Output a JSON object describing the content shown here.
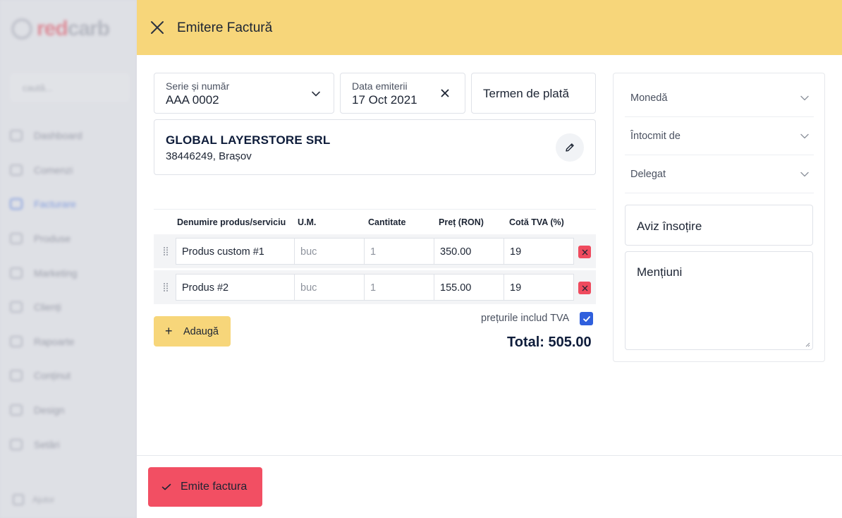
{
  "background_app": {
    "logo": {
      "part1": "red",
      "part2": "carb"
    },
    "search_placeholder": "caută...",
    "nav": [
      {
        "label": "Dashboard",
        "icon": "dashboard-icon"
      },
      {
        "label": "Comenzi",
        "icon": "cart-icon"
      },
      {
        "label": "Facturare",
        "icon": "invoice-icon",
        "active": true
      },
      {
        "label": "Produse",
        "icon": "tag-icon"
      },
      {
        "label": "Marketing",
        "icon": "megaphone-icon"
      },
      {
        "label": "Clienți",
        "icon": "user-icon"
      },
      {
        "label": "Rapoarte",
        "icon": "report-icon"
      },
      {
        "label": "Conținut",
        "icon": "document-icon"
      },
      {
        "label": "Design",
        "icon": "palette-icon"
      },
      {
        "label": "Setări",
        "icon": "gear-icon"
      }
    ],
    "footer_label": "Ajutor"
  },
  "header": {
    "title": "Emitere Factură",
    "close_icon": "close-icon"
  },
  "invoice": {
    "series": {
      "label": "Serie și număr",
      "value": "AAA 0002"
    },
    "date": {
      "label": "Data emiterii",
      "value": "17 Oct 2021"
    },
    "payment_term": {
      "placeholder": "Termen de plată"
    },
    "client": {
      "name": "GLOBAL LAYERSTORE SRL",
      "details": "38446249, Brașov"
    }
  },
  "table": {
    "columns": [
      "Denumire produs/serviciu",
      "U.M.",
      "Cantitate",
      "Preț (RON)",
      "Cotă TVA (%)"
    ],
    "rows": [
      {
        "name": "Produs custom #1",
        "unit": "buc",
        "qty": "1",
        "price": "350.00",
        "vat": "19"
      },
      {
        "name": "Produs #2",
        "unit": "buc",
        "qty": "1",
        "price": "155.00",
        "vat": "19"
      }
    ]
  },
  "actions": {
    "add_label": "Adaugă",
    "prices_include_vat_label": "prețurile includ TVA",
    "prices_include_vat": true,
    "total": "Total: 505.00",
    "submit_label": "Emite factura"
  },
  "side": {
    "currency_label": "Monedă",
    "issued_by_label": "Întocmit de",
    "delegate_label": "Delegat",
    "aviz_placeholder": "Aviz însoțire",
    "mentions_placeholder": "Mențiuni"
  },
  "colors": {
    "accent_yellow": "#f7d67a",
    "danger_red": "#f24f63",
    "checkbox_blue": "#2f5fdd",
    "active_nav_blue": "#3b6ee8"
  }
}
